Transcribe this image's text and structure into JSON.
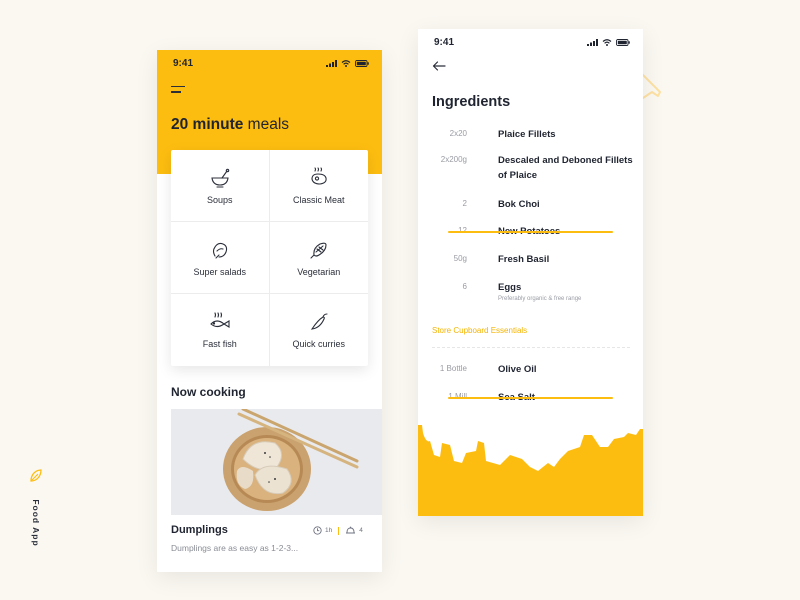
{
  "side_label": "Food App",
  "left_screen": {
    "status_time": "9:41",
    "title_bold": "20 minute",
    "title_rest": " meals",
    "categories": [
      {
        "label": "Soups",
        "icon": "bowl-icon"
      },
      {
        "label": "Classic Meat",
        "icon": "steak-icon"
      },
      {
        "label": "Super salads",
        "icon": "salad-icon"
      },
      {
        "label": "Vegetarian",
        "icon": "corn-icon"
      },
      {
        "label": "Fast fish",
        "icon": "fish-icon"
      },
      {
        "label": "Quick curries",
        "icon": "chili-icon"
      }
    ],
    "now_cooking_label": "Now cooking",
    "dish": {
      "title": "Dumplings",
      "description": "Dumplings are as easy as 1-2-3...",
      "time": "1h",
      "servings": "4"
    }
  },
  "right_screen": {
    "status_time": "9:41",
    "title": "Ingredients",
    "ingredients": [
      {
        "qty": "2x20",
        "name": "Plaice Fillets",
        "note": "",
        "struck": false
      },
      {
        "qty": "2x200g",
        "name": "Descaled and Deboned Fillets of Plaice",
        "note": "",
        "struck": false
      },
      {
        "qty": "2",
        "name": "Bok Choi",
        "note": "",
        "struck": false
      },
      {
        "qty": "12",
        "name": "New Potatoes",
        "note": "",
        "struck": true
      },
      {
        "qty": "50g",
        "name": "Fresh Basil",
        "note": "",
        "struck": false
      },
      {
        "qty": "6",
        "name": "Eggs",
        "note": "Preferably organic & free range",
        "struck": false
      }
    ],
    "section_label": "Store Cupboard Essentials",
    "cupboard": [
      {
        "qty": "1 Bottle",
        "name": "Olive Oil",
        "struck": false
      },
      {
        "qty": "1 Mill",
        "name": "Sea Salt",
        "struck": true
      }
    ]
  },
  "colors": {
    "accent": "#fdbd10",
    "text_dark": "#1f2430",
    "text_muted": "#9a9ca4",
    "background": "#fbf8f2"
  }
}
